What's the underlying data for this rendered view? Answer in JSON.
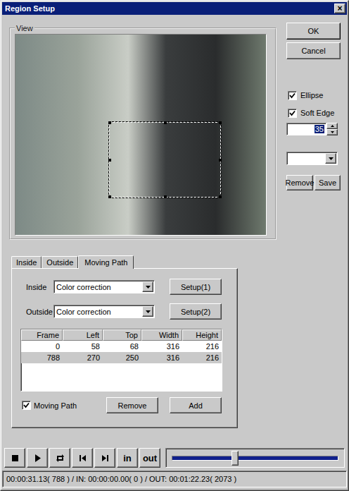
{
  "window": {
    "title": "Region Setup",
    "close": "×"
  },
  "view": {
    "label": "View"
  },
  "dialog_buttons": {
    "ok": "OK",
    "cancel": "Cancel"
  },
  "options": [
    {
      "label": "Ellipse",
      "checked": true
    },
    {
      "label": "Soft Edge",
      "checked": true
    }
  ],
  "soft_edge": {
    "value": "35",
    "selected": true
  },
  "preset": {
    "value": "",
    "buttons": [
      "Remove",
      "Save"
    ]
  },
  "tabs": [
    {
      "label": "Inside",
      "selected": false
    },
    {
      "label": "Outside",
      "selected": false
    },
    {
      "label": "Moving Path",
      "selected": true
    }
  ],
  "moving_path": {
    "effects": [
      {
        "label": "Inside",
        "value": "Color correction",
        "button": "Setup(1)"
      },
      {
        "label": "Outside",
        "value": "Color correction",
        "button": "Setup(2)"
      }
    ],
    "table": {
      "columns": [
        "Frame",
        "Left",
        "Top",
        "Width",
        "Height"
      ],
      "rows": [
        {
          "cells": [
            "0",
            "58",
            "68",
            "316",
            "216"
          ],
          "selected": false
        },
        {
          "cells": [
            "788",
            "270",
            "250",
            "316",
            "216"
          ],
          "selected": true
        }
      ]
    },
    "checkbox": {
      "label": "Moving Path",
      "checked": true
    },
    "buttons": [
      "Remove",
      "Add"
    ]
  },
  "transport": {
    "in": "in",
    "out": "out",
    "level": 0.38
  },
  "status_bar": "00:00:31.13( 788 ) / IN: 00:00:00.00( 0 ) / OUT: 00:01:22.23( 2073 )"
}
